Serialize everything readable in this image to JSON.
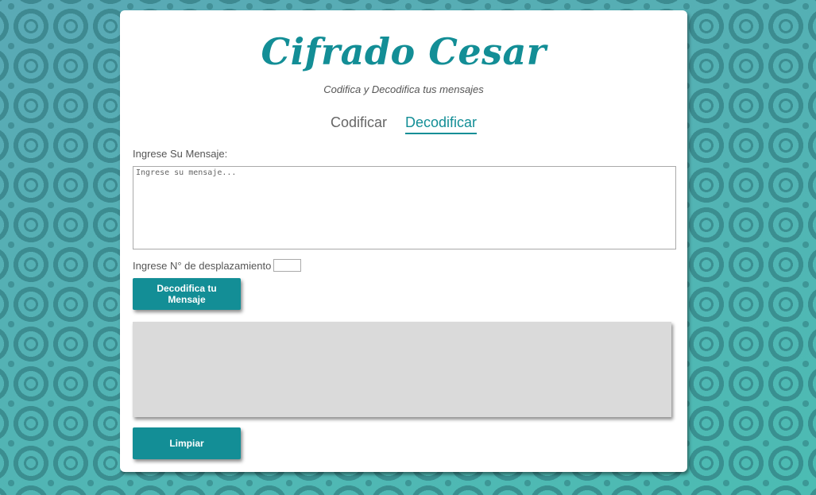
{
  "header": {
    "title": "Cifrado Cesar",
    "subtitle": "Codifica y Decodifica tus mensajes"
  },
  "tabs": [
    {
      "label": "Codificar",
      "active": false
    },
    {
      "label": "Decodificar",
      "active": true
    }
  ],
  "form": {
    "message_label": "Ingrese Su Mensaje:",
    "message_placeholder": "Ingrese su mensaje...",
    "message_value": "",
    "shift_label": "Ingrese N° de desplazamiento",
    "shift_value": "",
    "decode_button": "Decodifica tu Mensaje",
    "output_text": "",
    "clear_button": "Limpiar"
  },
  "colors": {
    "accent": "#138e96",
    "output_bg": "#dadada",
    "background": "#4fb3b3"
  }
}
